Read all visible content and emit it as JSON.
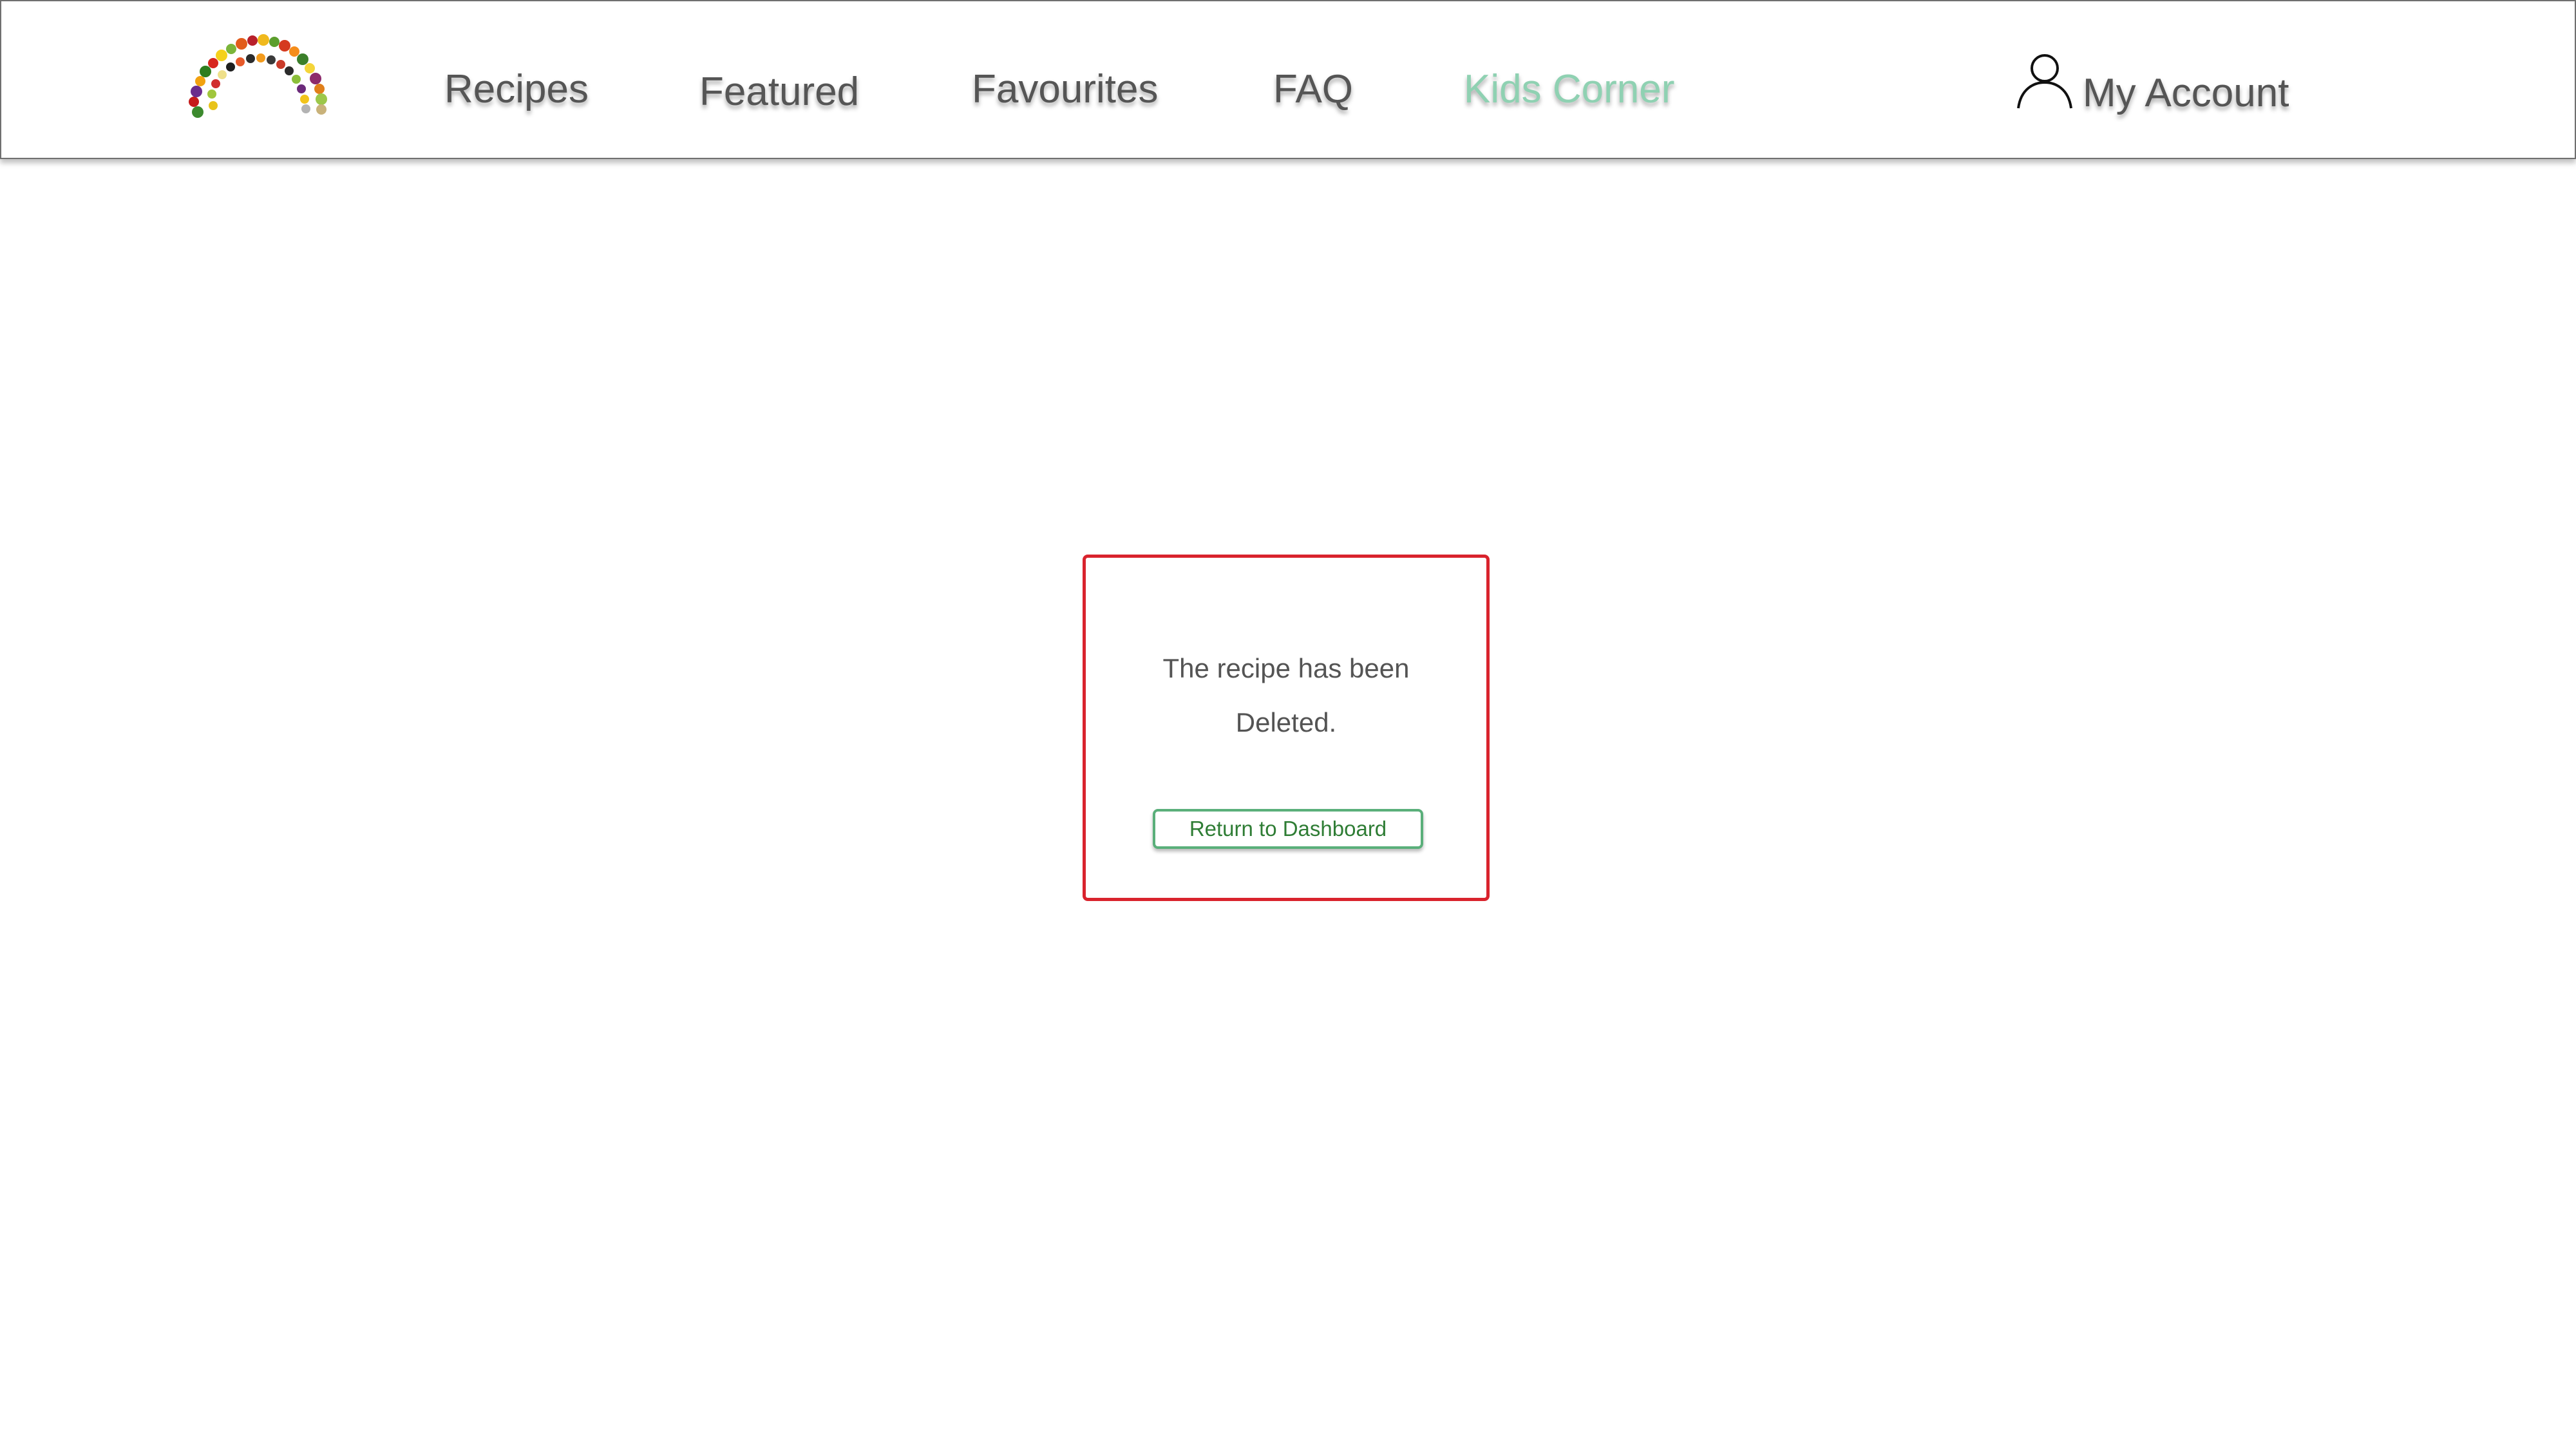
{
  "header": {
    "logo_icon": "fruit-vegetable-rainbow-logo-icon",
    "nav": {
      "recipes": "Recipes",
      "featured": "Featured",
      "favourites": "Favourites",
      "faq": "FAQ",
      "kids_corner": "Kids Corner"
    },
    "account": {
      "icon": "user-icon",
      "label": "My Account"
    }
  },
  "dialog": {
    "message_line1": "The recipe has been",
    "message_line2": "Deleted.",
    "button_label": "Return to Dashboard"
  },
  "colors": {
    "nav_text": "#555555",
    "kids_corner_accent": "#8fd1b2",
    "dialog_border": "#d9232d",
    "button_border": "#5aaf7a",
    "button_text": "#2f7d35"
  }
}
